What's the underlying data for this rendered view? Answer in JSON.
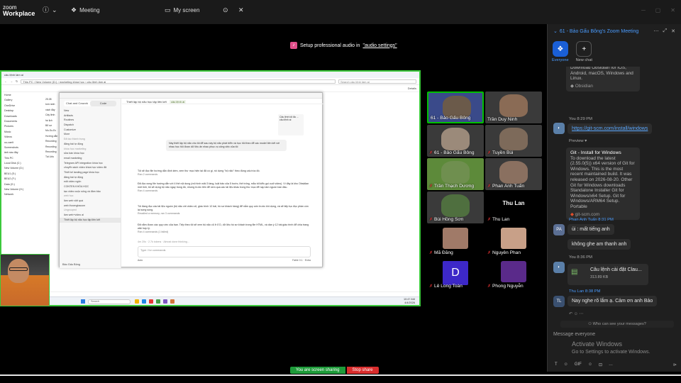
{
  "brand": {
    "line1": "zoom",
    "line2": "Workplace"
  },
  "topbar": {
    "meeting_label": "Meeting",
    "myscreen_label": "My screen"
  },
  "audio_tip": {
    "prefix": "Setup professional audio in ",
    "link": "\"audio settings\""
  },
  "explorer": {
    "title": "câu lệnh làm ai",
    "address": "This PC › New Volume (D:) › marketing khóa học › câu lệnh làm ai",
    "search_placeholder": "Search câu lệnh làm ai",
    "details_label": "Details",
    "sidebar": [
      "Home",
      "Gallery",
      "OneDrive",
      "Desktop",
      "Downloads",
      "Documents",
      "Pictures",
      "Music",
      "Videos",
      "uu-caelt",
      "Screenshots",
      "ảnh sàu đây",
      "This PC",
      "Local Disk (C:)",
      "New Volume (D:)",
      "BEU1 (E:)",
      "BEU2 (F:)",
      "Data (G:)",
      "New Volume (H:)",
      "Network"
    ],
    "files": [
      "25.08",
      "tom ranh",
      "xách đây",
      "Cây lệnh",
      "hẹ lịch",
      "Bổ sơ",
      "Mo-So-Ec",
      "Hướng dẫn",
      "Recording",
      "Recording",
      "Recording",
      "Tài Liệu"
    ]
  },
  "app": {
    "tabs": [
      "Chat and Cowork",
      "Code"
    ],
    "nav": [
      "New",
      "Artifacts",
      "Routines",
      "Dispatch",
      "Customize",
      "More"
    ],
    "section1": "Đã tạo thành trọng",
    "list1": [
      "đăng bài tự động"
    ],
    "section2": "khóa học marketing",
    "list2": [
      "sửa bán khóa học",
      "email marketing",
      "Telegram API integration khóa học",
      "chuyển sách video khóa học video đã",
      "Thiết kế landing page khóa học",
      "đăng bài tự động",
      "edit video ngôn",
      "CONTEN KHÓA HỌC",
      "tạo video cuộc sống và đảm bảo"
    ],
    "section3": "web học",
    "list3": [
      "làm web việt quá",
      "web thươngbacom"
    ],
    "section4": "Ungrouped",
    "list4": [
      "làm web+video ai",
      "Thiết lập bộ não học tập liên kết"
    ],
    "user_name": "Bảo Gấu Bông",
    "thread_title": "Thiết lập bộ não học tập liên kết",
    "thread_tag": "câu lệnh ai",
    "quote": "Câu lệnh tối đa ... câu lệnh ai",
    "user_msg": "Này thiết lập bộ não cho tôi để sau này bộ não phát triển và học hỏi theo để các model liên kết với nhau học hỏi được dữ liệu ấn nhau phục vụ công việc của tôi",
    "answers": [
      {
        "title": "Tôi sẽ đọc file hướng dẫn định kèm, xem thư mục hiện tại đã có gì, rồi dựng \"bộ não\" theo đúng cấu trúc đó.",
        "meta": "Ran 2 commands"
      },
      {
        "title": "Đã đọc xong file hướng dẫn với 4 thẻ nội dung (mô hình wiki 3 tầng, luật bảo của 5 bước, thẻ trống, mẫu tối kiểu gọi cuối video). Vì đây là kho Obsidian mới tinh, tôi sẽ dựng bộ não ngay trong đó, nhưng trước tiên để xem qua các tài liệu khác trong thư mục để nạp làm nguồn ban đầu.",
        "meta": "Ran 4 commands"
      },
      {
        "title": "Tôi đang đọc các tài liệu nguồn (bộ não với video cũ, giáo trình 12 bài, hồ sơ khách hàng) để nắm quy ước trước khi dựng, và sẽ tiếp tục đọc phần còn lại song song.",
        "meta": "Recalled a memory, ran 3 commands"
      },
      {
        "title": "Đã nắm được các quy ước của bạn. Tiếp theo tôi sẽ xem bộ não cũ ở ổ D, dữ liệu hồ sơ khách trong file HTML, và dàn ý 12 bài giáo trình để chia trang wiki hợp lý.",
        "meta": "Ran 4 commands (1 failed)"
      }
    ],
    "running": "4m 20s · 2.7k tokens · Almost done thinking...",
    "composer_placeholder": "Type / for commands",
    "footer_left": "Auto",
    "footer_right": "Fable 0.1 · Extra"
  },
  "taskbar": {
    "search": "Search",
    "time": "10:47 AM",
    "date": "4/4/2026"
  },
  "gallery": {
    "tiles": [
      {
        "name": "61 - Bảo Gấu Bông",
        "muted": false,
        "active": true
      },
      {
        "name": "Trần Duy Ninh",
        "muted": false
      },
      {
        "name": "61 - Bảo Gấu Bông",
        "muted": true
      },
      {
        "name": "Tuyền Bùi",
        "muted": true
      },
      {
        "name": "Trần Thạch Dương",
        "muted": true
      },
      {
        "name": "Phan Anh Tuấn",
        "muted": true
      },
      {
        "name": "Bùi Hồng Sơn",
        "muted": true
      },
      {
        "name": "Thu Lan",
        "muted": true,
        "big": "Thu Lan"
      },
      {
        "name": "Mã Đăng",
        "muted": true
      },
      {
        "name": "Nguyên Phan",
        "muted": true
      },
      {
        "name": "Lê Long Toàn",
        "muted": true,
        "letter": "D"
      },
      {
        "name": "Phong Nguyễn",
        "muted": true
      }
    ]
  },
  "chat": {
    "title": "61 - Bảo Gấu Bông's Zoom Meeting",
    "tabs": [
      {
        "label": "Everyone"
      },
      {
        "label": "New chat"
      }
    ],
    "card1_text": "Download Obsidian for iOS, Android, macOS, Windows and Linux.",
    "card1_link": "Obsidian",
    "msg1_sender": "You 8:29 PM",
    "msg1_link": "https://git-scm.com/install/windows",
    "preview_label": "Preview ▾",
    "card2_title": "Git - Install for Windows",
    "card2_text": "To download the latest (2.55.0(5)) x64 version of Git for Windows. This is the most recent maintained build. It was released on 2026-08-20. Other Git for Windows downloads Standalone Installer Git for Windows/x64 Setup. Git for Windows/ARM64 Setup. Portable",
    "card2_link": "git-scm.com",
    "msg2_sender": "Phan Anh Tuấn 8:31 PM",
    "msg2_avatar": "PA",
    "msg2_a": "ủi : mất  tiếng anh",
    "msg2_b": "không ghe am thanh anh",
    "msg3_sender": "You 8:36 PM",
    "msg3_file": "Câu lệnh cài đặt Clau...",
    "msg3_size": "313.89 KB",
    "msg4_sender": "Thu Lan 8:38 PM",
    "msg4_avatar": "TL",
    "msg4_text": "Nay nghe rõ lắm ạ. Cảm ơn anh Bảo",
    "who_can_see": "Who can see your messages?",
    "placeholder": "Message everyone",
    "activate_title": "Activate Windows",
    "activate_sub": "Go to Settings to activate Windows.",
    "tools": [
      "T",
      "☺",
      "GIF",
      "☺",
      "⊡",
      "…",
      "⊳"
    ]
  },
  "sharing": {
    "status": "You are screen sharing",
    "stop": "Stop share"
  },
  "colors": {
    "accent": "#1a5fd6",
    "share_green": "#1e9b3a",
    "stop_red": "#d92d2d"
  }
}
